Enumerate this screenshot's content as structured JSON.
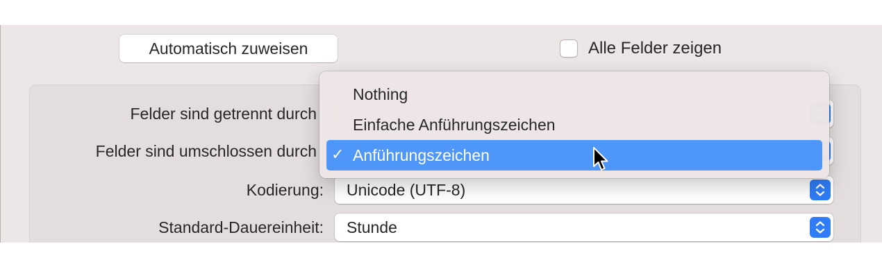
{
  "dialog": {
    "auto_assign_button": "Automatisch zuweisen",
    "show_all_fields": {
      "label": "Alle Felder zeigen",
      "checked": false
    }
  },
  "settings": {
    "fields_separated": {
      "label": "Felder sind getrennt durch"
    },
    "fields_enclosed": {
      "label": "Felder sind umschlossen durch"
    },
    "encoding": {
      "label": "Kodierung:",
      "value": "Unicode (UTF-8)"
    },
    "default_duration_unit": {
      "label": "Standard-Dauereinheit:",
      "value": "Stunde"
    }
  },
  "dropdown_menu": {
    "items": [
      {
        "label": "Nothing",
        "selected": false
      },
      {
        "label": "Einfache Anführungszeichen",
        "selected": false
      },
      {
        "label": "Anführungszeichen",
        "selected": true
      }
    ],
    "checkmark": "✓"
  },
  "colors": {
    "accent": "#2f7cf6",
    "menu_highlight": "#4f96f9",
    "window_bg": "#ece7e6",
    "panel_bg": "#e3dedd"
  },
  "icons": {
    "stepper": "up-down-chevron-icon",
    "cursor": "mouse-pointer-icon"
  }
}
